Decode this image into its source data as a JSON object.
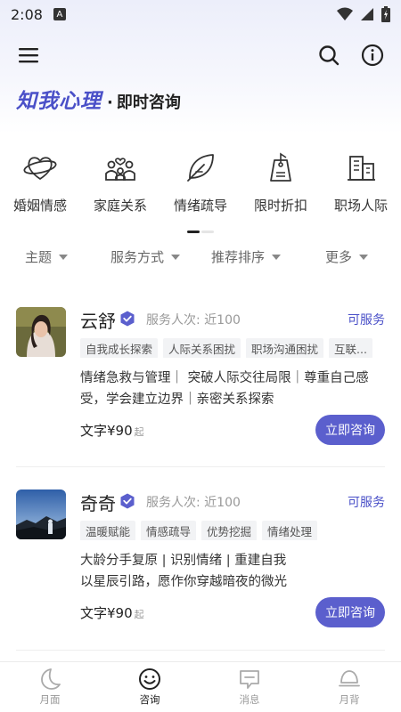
{
  "status_bar": {
    "time": "2:08",
    "badge": "A"
  },
  "header": {
    "brand": "知我心理",
    "separator": "·",
    "subtitle": "即时咨询"
  },
  "categories": [
    {
      "label": "婚姻情感",
      "icon": "heart-ring-icon"
    },
    {
      "label": "家庭关系",
      "icon": "family-icon"
    },
    {
      "label": "情绪疏导",
      "icon": "leaf-icon"
    },
    {
      "label": "限时折扣",
      "icon": "price-tag-icon"
    },
    {
      "label": "职场人际",
      "icon": "building-icon"
    }
  ],
  "filters": [
    "主题",
    "服务方式",
    "推荐排序",
    "更多"
  ],
  "counselors": [
    {
      "name": "云舒",
      "served": "服务人次: 近100",
      "status": "可服务",
      "tags": [
        "自我成长探索",
        "人际关系困扰",
        "职场沟通困扰",
        "互联..."
      ],
      "description": "情绪急救与管理｜ 突破人际交往局限｜尊重自己感受，学会建立边界｜亲密关系探索",
      "price": "文字¥90",
      "price_suffix": "起",
      "button": "立即咨询"
    },
    {
      "name": "奇奇",
      "served": "服务人次: 近100",
      "status": "可服务",
      "tags": [
        "温暖赋能",
        "情感疏导",
        "优势挖掘",
        "情绪处理"
      ],
      "description": "大龄分手复原 | 识别情绪 | 重建自我\n以星辰引路，愿作你穿越暗夜的微光",
      "price": "文字¥90",
      "price_suffix": "起",
      "button": "立即咨询"
    }
  ],
  "tabs": [
    {
      "label": "月面",
      "icon": "moon-icon",
      "active": false
    },
    {
      "label": "咨询",
      "icon": "smile-icon",
      "active": true
    },
    {
      "label": "消息",
      "icon": "message-icon",
      "active": false
    },
    {
      "label": "月背",
      "icon": "moon-dome-icon",
      "active": false
    }
  ],
  "colors": {
    "brand": "#4a50c8",
    "button": "#5b5fcd",
    "status": "#4a50c8"
  }
}
